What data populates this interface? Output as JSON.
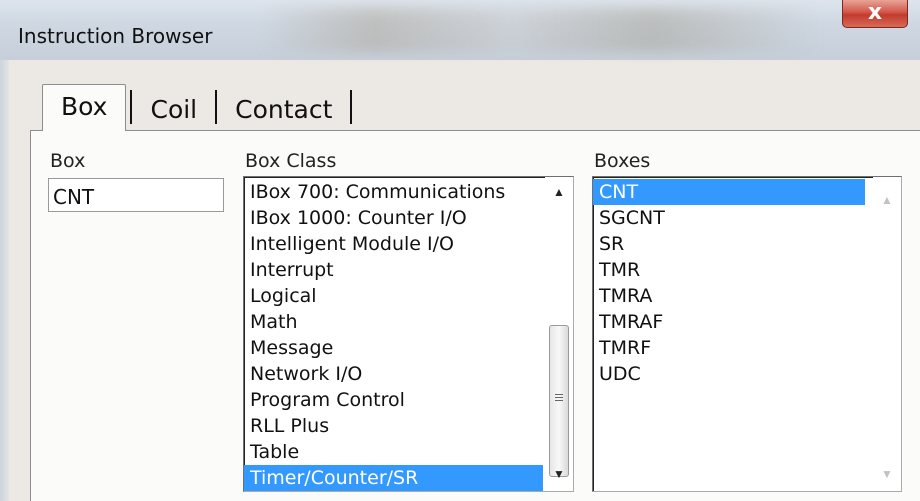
{
  "window": {
    "title": "Instruction Browser",
    "close_symbol": "x"
  },
  "tabs": [
    {
      "label": "Box",
      "active": true
    },
    {
      "label": "Coil",
      "active": false
    },
    {
      "label": "Contact",
      "active": false
    }
  ],
  "box_field": {
    "label": "Box",
    "value": "CNT"
  },
  "box_class": {
    "label": "Box Class",
    "items": [
      "IBox  700: Communications",
      "IBox 1000: Counter I/O",
      "Intelligent Module I/O",
      "Interrupt",
      "Logical",
      "Math",
      "Message",
      "Network I/O",
      "Program Control",
      "RLL Plus",
      "Table",
      "Timer/Counter/SR"
    ],
    "selected": "Timer/Counter/SR"
  },
  "boxes": {
    "label": "Boxes",
    "items": [
      "CNT",
      "SGCNT",
      "SR",
      "TMR",
      "TMRA",
      "TMRAF",
      "TMRF",
      "UDC"
    ],
    "selected": "CNT"
  },
  "colors": {
    "selection": "#3399ff",
    "close_button": "#c23b2e"
  },
  "icons": {
    "scroll_up": "▲",
    "scroll_down": "▼"
  }
}
